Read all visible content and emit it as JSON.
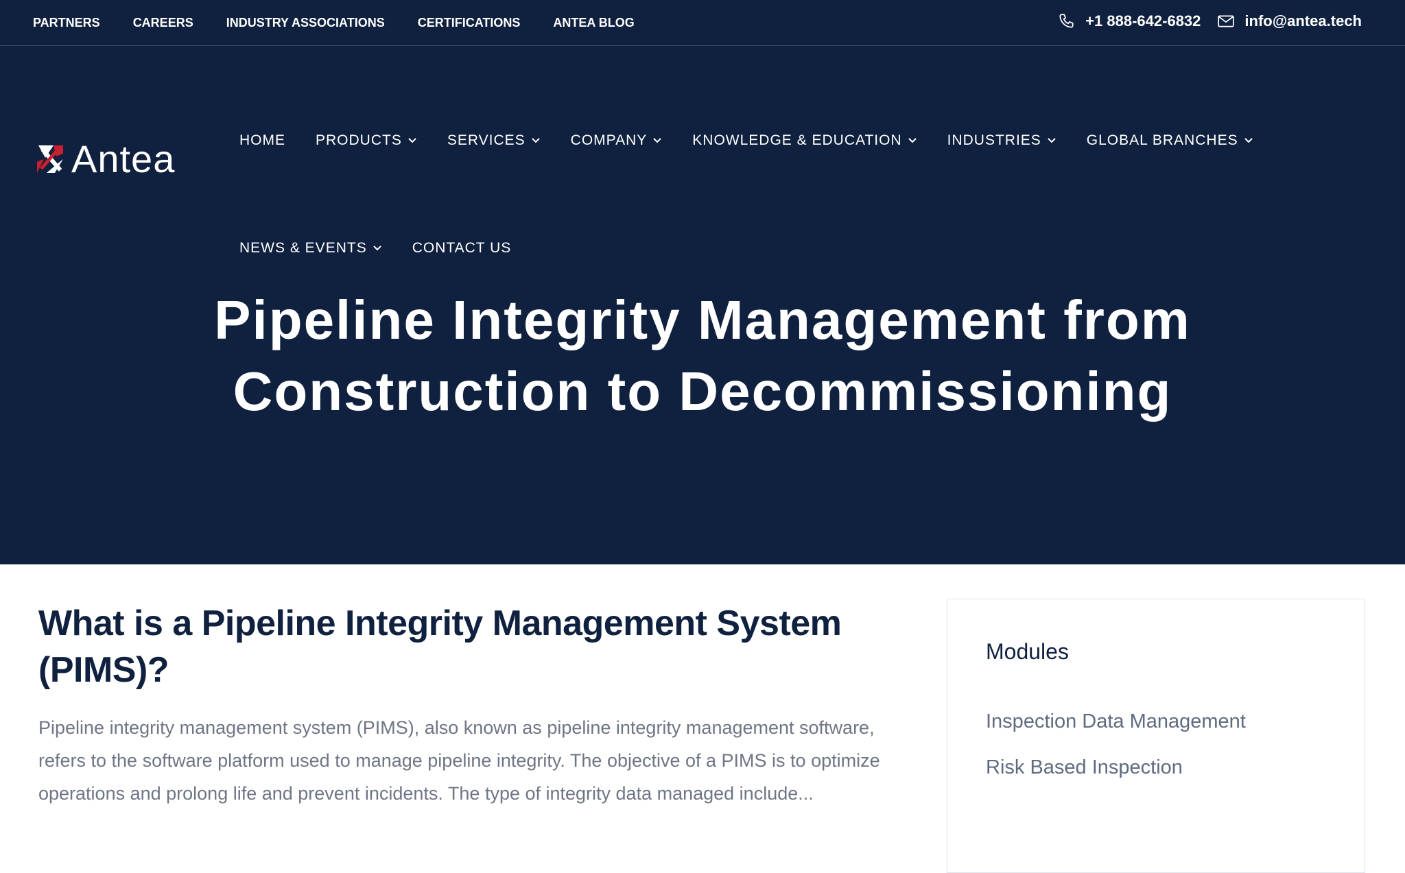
{
  "topbar": {
    "links": [
      "PARTNERS",
      "CAREERS",
      "INDUSTRY ASSOCIATIONS",
      "CERTIFICATIONS",
      "ANTEA BLOG"
    ],
    "phone": "+1 888-642-6832",
    "email": "info@antea.tech"
  },
  "logo": {
    "text": "Antea",
    "colors": {
      "red": "#c8202f",
      "white": "#ffffff"
    }
  },
  "nav": {
    "row1": [
      {
        "label": "HOME",
        "dropdown": false
      },
      {
        "label": "PRODUCTS",
        "dropdown": true
      },
      {
        "label": "SERVICES",
        "dropdown": true
      },
      {
        "label": "COMPANY",
        "dropdown": true
      },
      {
        "label": "KNOWLEDGE & EDUCATION",
        "dropdown": true
      },
      {
        "label": "INDUSTRIES",
        "dropdown": true
      },
      {
        "label": "GLOBAL BRANCHES",
        "dropdown": true
      }
    ],
    "row2": [
      {
        "label": "NEWS & EVENTS",
        "dropdown": true
      },
      {
        "label": "CONTACT US",
        "dropdown": false
      }
    ]
  },
  "hero": {
    "line1": "Pipeline Integrity Management from",
    "line2": "Construction to Decommissioning"
  },
  "main": {
    "heading_line1": "What is a Pipeline Integrity Management System",
    "heading_line2": "(PIMS)?",
    "paragraph": "Pipeline integrity management system (PIMS), also known as pipeline integrity management software, refers to the software platform used to manage pipeline integrity. The objective of a PIMS is to optimize operations and prolong life and prevent incidents. The type of integrity data managed include..."
  },
  "sidebar": {
    "title": "Modules",
    "items": [
      "Inspection Data Management",
      "Risk Based Inspection"
    ]
  },
  "colors": {
    "navy": "#10213f",
    "text_gray": "#6e7585",
    "link_gray": "#5f6b80"
  }
}
